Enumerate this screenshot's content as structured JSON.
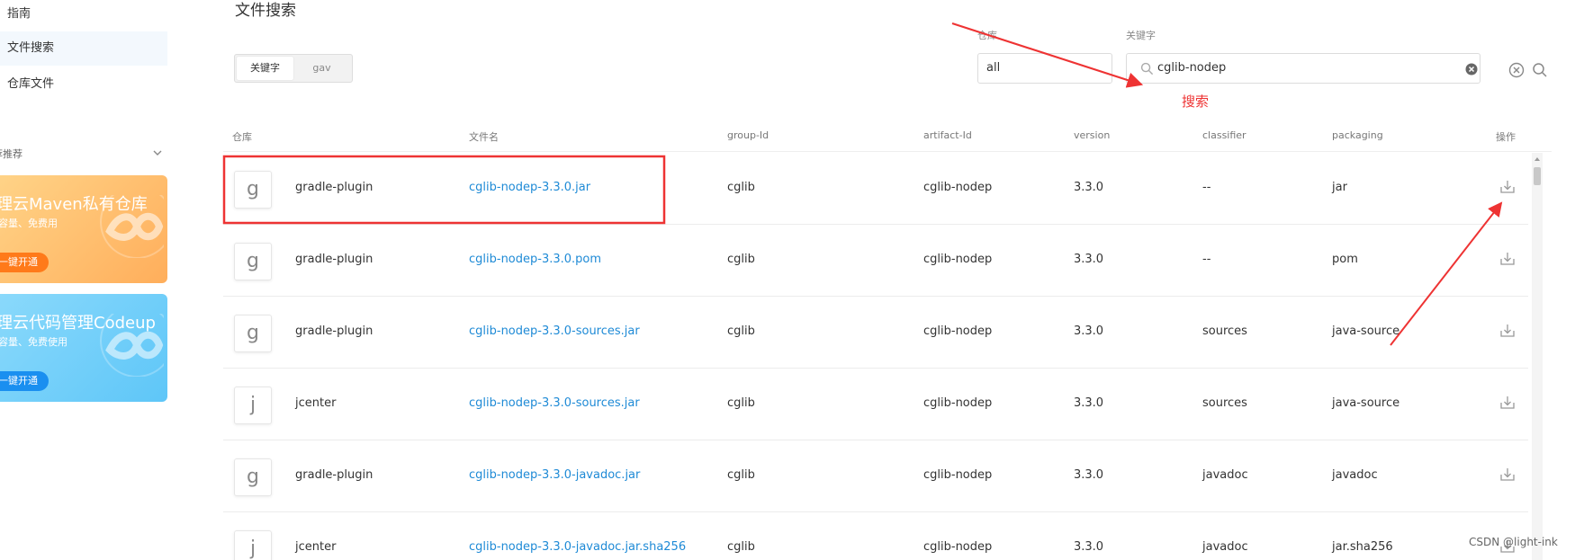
{
  "sidebar": {
    "items": [
      {
        "label": "指南",
        "active": false
      },
      {
        "label": "文件搜索",
        "active": true
      },
      {
        "label": "仓库文件",
        "active": false
      }
    ],
    "recommend_title": "荐推荐",
    "promos": [
      {
        "title": "理云Maven私有仓库",
        "subtitle": "容量、免费用",
        "button": "一键开通",
        "color": "#ffae5b"
      },
      {
        "title": "理云代码管理Codeup",
        "subtitle": "容量、免费使用",
        "button": "一键开通",
        "color": "#5ec6f8"
      }
    ]
  },
  "header": {
    "title": "文件搜索",
    "mode_tabs": [
      {
        "label": "关键字",
        "active": true
      },
      {
        "label": "gav",
        "active": false
      }
    ],
    "repo_label": "仓库",
    "repo_value": "all",
    "keyword_label": "关键字",
    "keyword_value": "cglib-nodep"
  },
  "table": {
    "columns": [
      "仓库",
      "文件名",
      "group-Id",
      "artifact-Id",
      "version",
      "classifier",
      "packaging",
      "操作"
    ],
    "rows": [
      {
        "badge": "g",
        "repo": "gradle-plugin",
        "filename": "cglib-nodep-3.3.0.jar",
        "group": "cglib",
        "artifact": "cglib-nodep",
        "version": "3.3.0",
        "classifier": "--",
        "packaging": "jar"
      },
      {
        "badge": "g",
        "repo": "gradle-plugin",
        "filename": "cglib-nodep-3.3.0.pom",
        "group": "cglib",
        "artifact": "cglib-nodep",
        "version": "3.3.0",
        "classifier": "--",
        "packaging": "pom"
      },
      {
        "badge": "g",
        "repo": "gradle-plugin",
        "filename": "cglib-nodep-3.3.0-sources.jar",
        "group": "cglib",
        "artifact": "cglib-nodep",
        "version": "3.3.0",
        "classifier": "sources",
        "packaging": "java-source"
      },
      {
        "badge": "j",
        "repo": "jcenter",
        "filename": "cglib-nodep-3.3.0-sources.jar",
        "group": "cglib",
        "artifact": "cglib-nodep",
        "version": "3.3.0",
        "classifier": "sources",
        "packaging": "java-source"
      },
      {
        "badge": "g",
        "repo": "gradle-plugin",
        "filename": "cglib-nodep-3.3.0-javadoc.jar",
        "group": "cglib",
        "artifact": "cglib-nodep",
        "version": "3.3.0",
        "classifier": "javadoc",
        "packaging": "javadoc"
      },
      {
        "badge": "j",
        "repo": "jcenter",
        "filename": "cglib-nodep-3.3.0-javadoc.jar.sha256",
        "group": "cglib",
        "artifact": "cglib-nodep",
        "version": "3.3.0",
        "classifier": "javadoc",
        "packaging": "jar.sha256"
      }
    ]
  },
  "annotations": {
    "search_label": "搜索",
    "color": "#ee3333"
  },
  "watermark": "CSDN @light-ink"
}
